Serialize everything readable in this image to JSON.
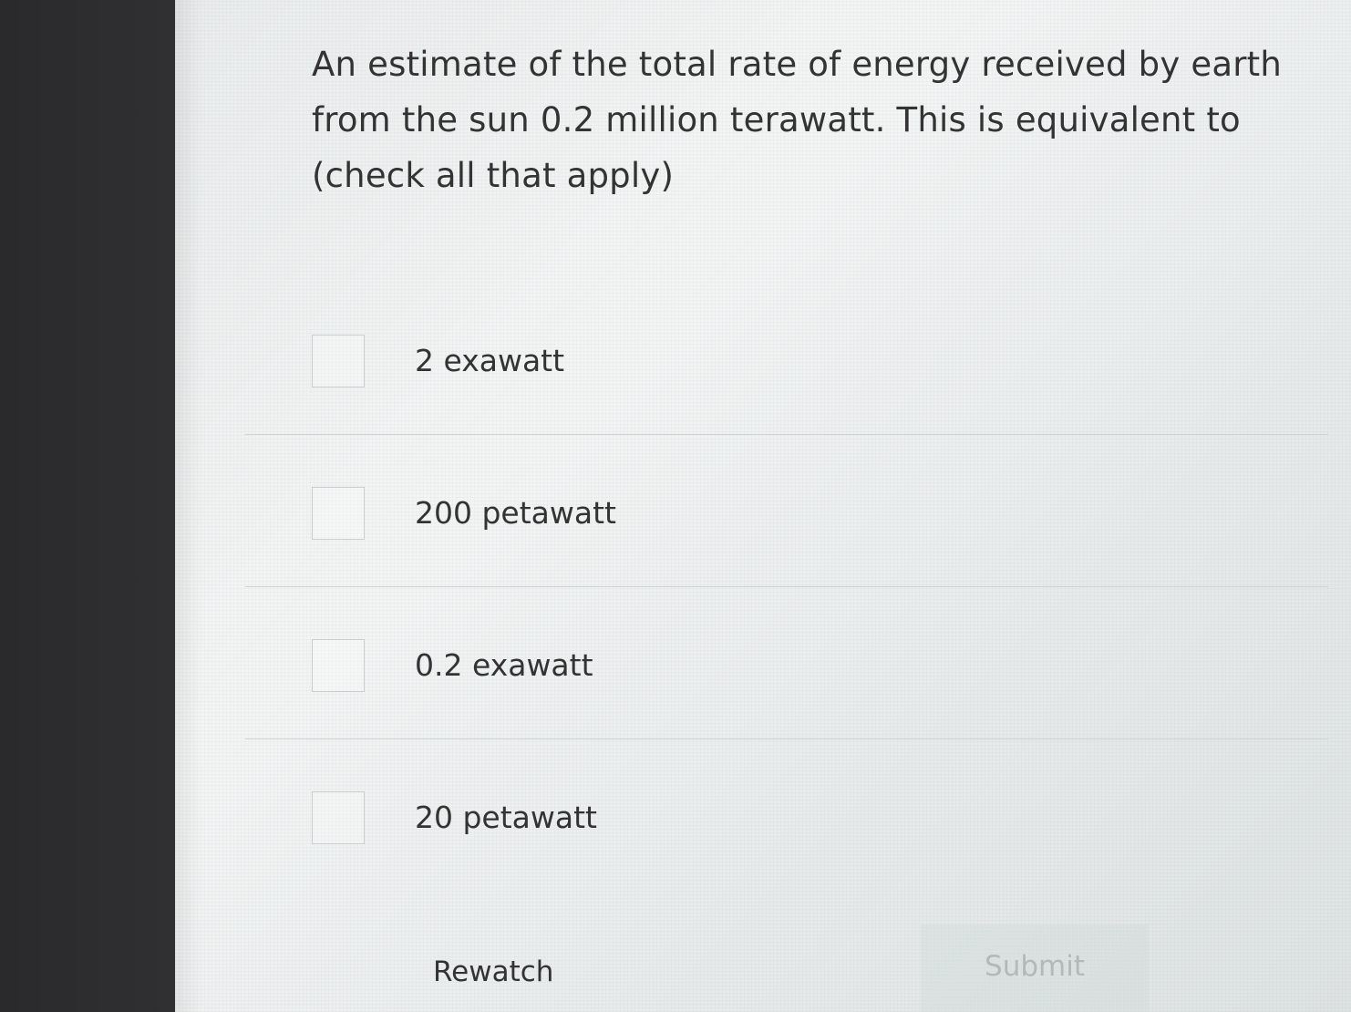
{
  "question": {
    "lines": [
      "An estimate of the total rate of energy received by earth",
      "from the sun 0.2 million terawatt.  This is equivalent to",
      "(check all that apply)"
    ]
  },
  "options": [
    {
      "label": "2 exawatt",
      "checked": false
    },
    {
      "label": "200 petawatt",
      "checked": false
    },
    {
      "label": "0.2 exawatt",
      "checked": false
    },
    {
      "label": "20 petawatt",
      "checked": false
    }
  ],
  "actions": {
    "rewatch_label": "Rewatch",
    "submit_label": "Submit"
  }
}
